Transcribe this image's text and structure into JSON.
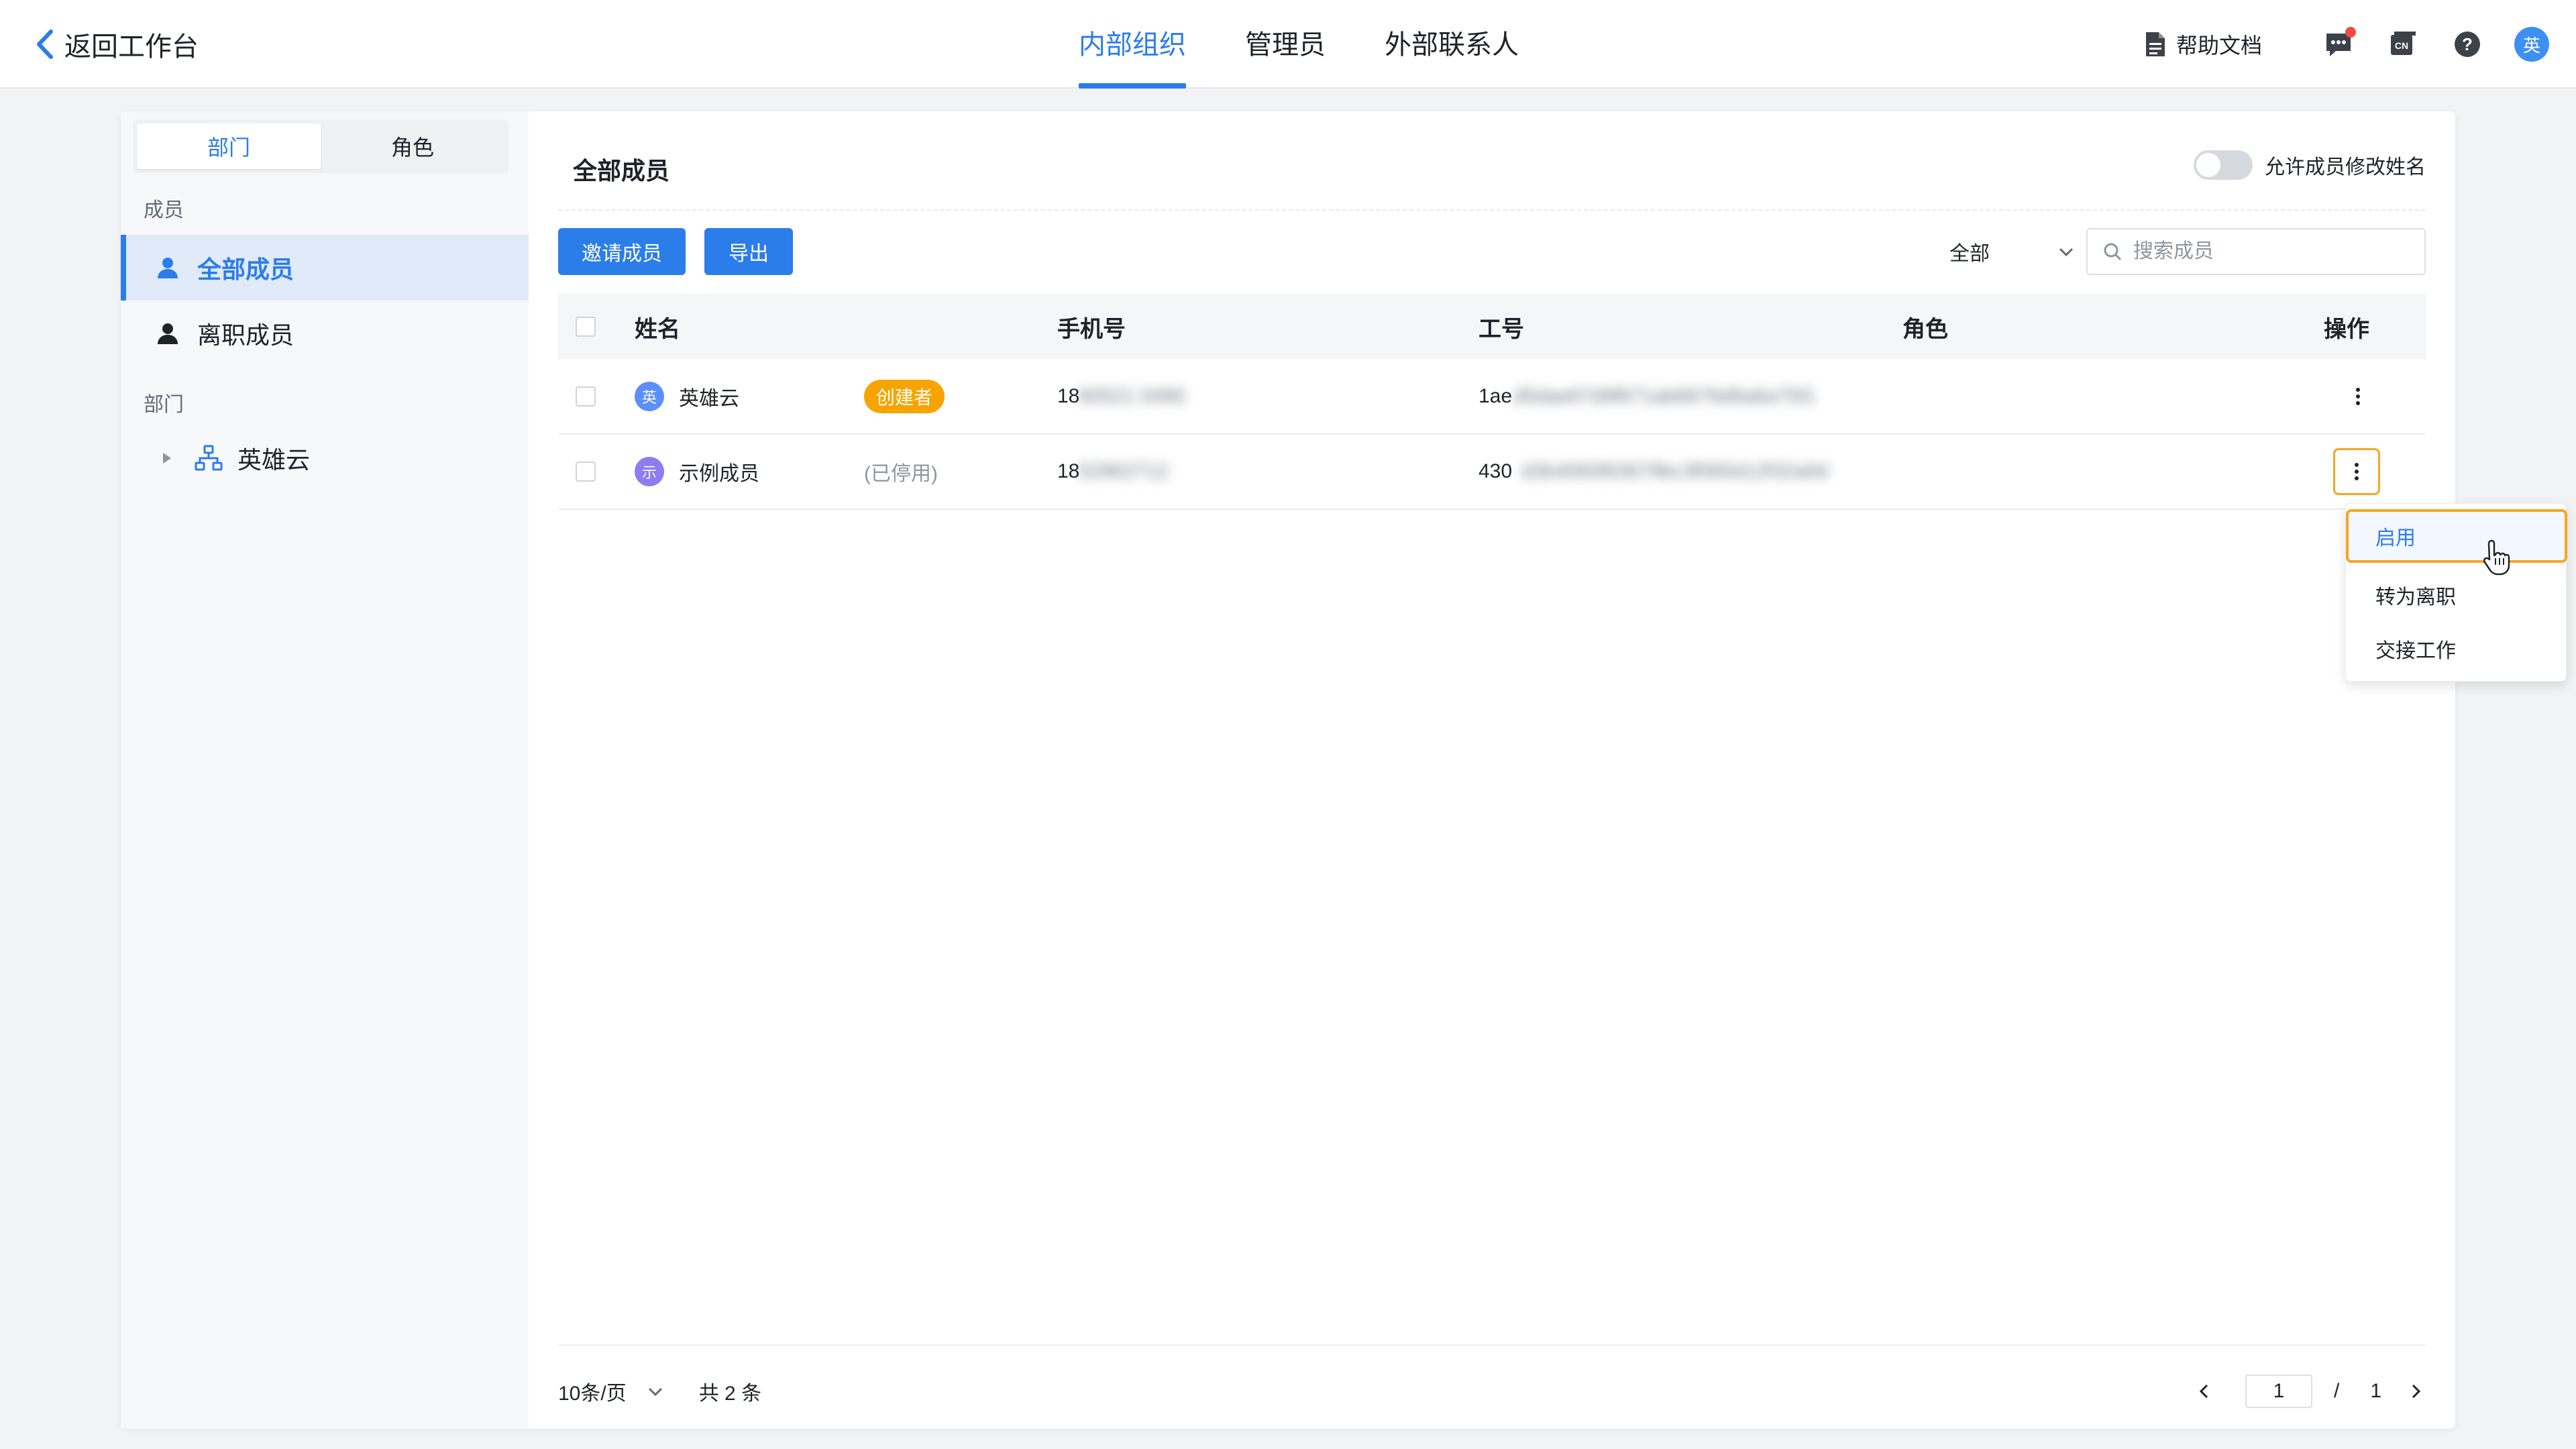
{
  "header": {
    "back_label": "返回工作台",
    "tabs": [
      {
        "label": "内部组织",
        "active": true
      },
      {
        "label": "管理员",
        "active": false
      },
      {
        "label": "外部联系人",
        "active": false
      }
    ],
    "help_label": "帮助文档",
    "icons": [
      "doc-icon",
      "message-icon",
      "cn-language-icon",
      "help-icon"
    ],
    "avatar_text": "英",
    "accent_color": "#2b7de9"
  },
  "sidebar": {
    "segments": [
      {
        "label": "部门",
        "active": true
      },
      {
        "label": "角色",
        "active": false
      }
    ],
    "members_section": "成员",
    "items": [
      {
        "label": "全部成员",
        "active": true
      },
      {
        "label": "离职成员",
        "active": false
      }
    ],
    "dept_section": "部门",
    "tree": [
      {
        "label": "英雄云",
        "expanded": false
      }
    ]
  },
  "main": {
    "title": "全部成员",
    "toggle_label": "允许成员修改姓名",
    "toggle_on": false,
    "invite_button": "邀请成员",
    "export_button": "导出",
    "filter_value": "全部",
    "search_placeholder": "搜索成员",
    "columns": [
      "姓名",
      "手机号",
      "工号",
      "角色",
      "操作"
    ],
    "rows": [
      {
        "avatar": "英",
        "avatar_color": "#5b8ff9",
        "name": "英雄云",
        "tag": "创建者",
        "phone_prefix": "18",
        "phone_hidden": "60521 0490",
        "id_prefix": "1ae",
        "id_hidden": "d5dae67d9f671ab6676d6a6a75f1",
        "role": ""
      },
      {
        "avatar": "示",
        "avatar_color": "#8e7cf0",
        "name": "示例成员",
        "tag": "(已停用)",
        "phone_prefix": "18",
        "phone_hidden": "52962712",
        "id_prefix": "430",
        "id_hidden": "d3b4065f63679bc3f065d12f32a0d",
        "role": ""
      }
    ]
  },
  "action_menu": {
    "items": [
      {
        "label": "启用",
        "highlighted": true
      },
      {
        "label": "转为离职",
        "highlighted": false
      },
      {
        "label": "交接工作",
        "highlighted": false
      }
    ]
  },
  "pagination": {
    "page_size_label": "10条/页",
    "total_label": "共 2 条",
    "current_page": "1",
    "separator": "/",
    "total_pages": "1"
  }
}
